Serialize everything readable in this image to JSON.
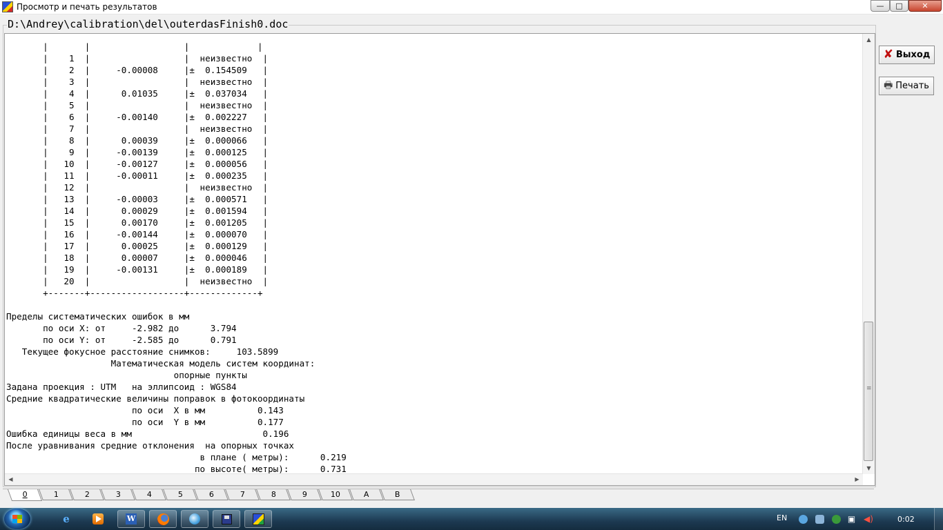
{
  "window": {
    "title": "Просмотр и печать результатов",
    "controls": {
      "minimize": "—",
      "maximize": "□",
      "close": "✕"
    }
  },
  "group": {
    "caption": "D:\\Andrey\\calibration\\del\\outerdasFinish0.doc"
  },
  "report": {
    "lines": [
      "       |       |                  |             |",
      "       |    1  |                  |  неизвестно  |",
      "       |    2  |     -0.00008     |±  0.154509   |",
      "       |    3  |                  |  неизвестно  |",
      "       |    4  |      0.01035     |±  0.037034   |",
      "       |    5  |                  |  неизвестно  |",
      "       |    6  |     -0.00140     |±  0.002227   |",
      "       |    7  |                  |  неизвестно  |",
      "       |    8  |      0.00039     |±  0.000066   |",
      "       |    9  |     -0.00139     |±  0.000125   |",
      "       |   10  |     -0.00127     |±  0.000056   |",
      "       |   11  |     -0.00011     |±  0.000235   |",
      "       |   12  |                  |  неизвестно  |",
      "       |   13  |     -0.00003     |±  0.000571   |",
      "       |   14  |      0.00029     |±  0.001594   |",
      "       |   15  |      0.00170     |±  0.001205   |",
      "       |   16  |     -0.00144     |±  0.000070   |",
      "       |   17  |      0.00025     |±  0.000129   |",
      "       |   18  |      0.00007     |±  0.000046   |",
      "       |   19  |     -0.00131     |±  0.000189   |",
      "       |   20  |                  |  неизвестно  |",
      "       +-------+------------------+-------------+",
      "",
      "Пределы систематических ошибок в мм",
      "       по оси X: от     -2.982 до      3.794",
      "       по оси Y: от     -2.585 до      0.791",
      "   Текущее фокусное расстояние снимков:     103.5899",
      "                    Математическая модель систем координат:",
      "                                опорные пункты",
      "Задана проекция : UTM   на эллипсоид : WGS84",
      "Средние квадратические величины поправок в фотокоординаты",
      "                        по оси  X в мм          0.143",
      "                        по оси  Y в мм          0.177",
      "Ошибка единицы веса в мм                         0.196",
      "После уравнивания средние отклонения  на опорных точках",
      "                                     в плане ( метры):      0.219",
      "                                    по высоте( метры):      0.731"
    ]
  },
  "buttons": {
    "exit_label": "Выход",
    "print_label": "Печать",
    "exit_icon": "x-icon",
    "print_icon": "printer-icon"
  },
  "tabs": [
    "0",
    "1",
    "2",
    "3",
    "4",
    "5",
    "6",
    "7",
    "8",
    "9",
    "10",
    "A",
    "B"
  ],
  "active_tab": "0",
  "taskbar": {
    "ie_glyph": "e",
    "word_glyph": "W",
    "language": "EN",
    "clock": "0:02"
  }
}
